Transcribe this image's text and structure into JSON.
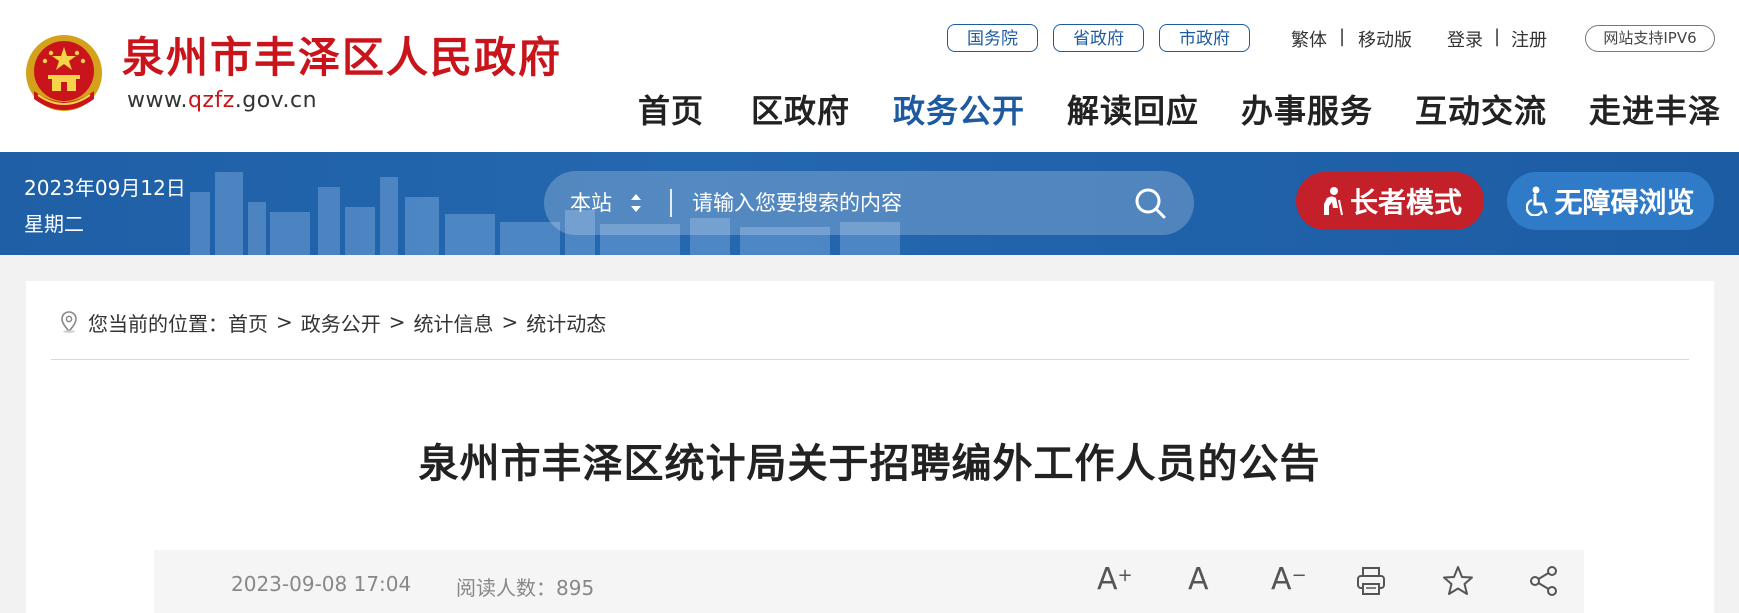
{
  "header": {
    "site_name": "泉州市丰泽区人民政府",
    "domain_prefix": "www.",
    "domain_highlight": "qzfz",
    "domain_suffix": ".gov.cn",
    "gov_links": [
      "国务院",
      "省政府",
      "市政府"
    ],
    "traditional": "繁体",
    "mobile": "移动版",
    "login": "登录",
    "register": "注册",
    "separator": "|",
    "ipv6": "网站支持IPV6",
    "nav": [
      "首页",
      "区政府",
      "政务公开",
      "解读回应",
      "办事服务",
      "互动交流",
      "走进丰泽"
    ],
    "nav_active": "政务公开"
  },
  "banner": {
    "date": "2023年09月12日",
    "weekday": "星期二",
    "search_scope": "本站",
    "search_placeholder": "请输入您要搜索的内容",
    "elder_mode": "长者模式",
    "accessible": "无障碍浏览"
  },
  "breadcrumb": {
    "prefix": "您当前的位置：",
    "items": [
      "首页",
      "政务公开",
      "统计信息",
      "统计动态"
    ],
    "separator": ">"
  },
  "article": {
    "title": "泉州市丰泽区统计局关于招聘编外工作人员的公告",
    "publish_time": "2023-09-08 17:04",
    "views_label": "阅读人数：",
    "views": "895",
    "font_large": "A",
    "font_large_mark": "+",
    "font_normal": "A",
    "font_small": "A",
    "font_small_mark": "−"
  },
  "colors": {
    "brand_red": "#c8141a",
    "nav_active": "#1e5aa0",
    "banner_blue": "#1f5fa6",
    "elder_red": "#c4202a",
    "access_blue": "#2f7bc8"
  },
  "icons": [
    "national-emblem-icon",
    "sort-arrows-icon",
    "search-icon",
    "elder-icon",
    "wheelchair-icon",
    "location-pin-icon",
    "print-icon",
    "star-icon",
    "share-icon"
  ]
}
